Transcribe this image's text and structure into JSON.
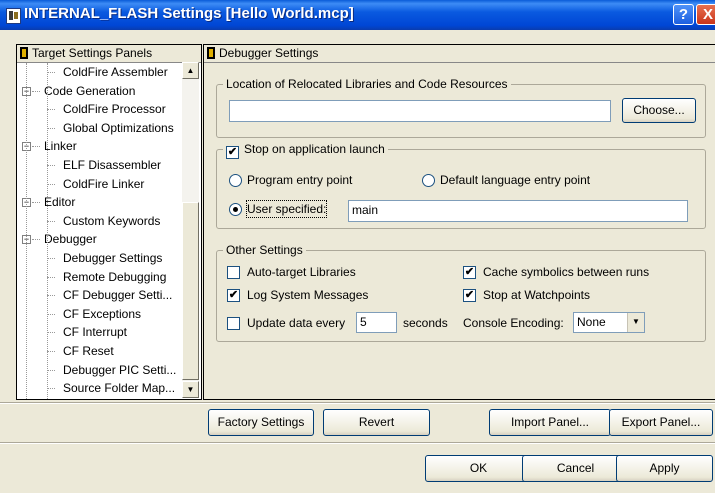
{
  "window": {
    "title": "INTERNAL_FLASH Settings [Hello World.mcp]",
    "help_symbol": "?",
    "close_symbol": "X"
  },
  "left_panel": {
    "header": "Target Settings Panels",
    "tree": [
      {
        "label": "ColdFire Assembler",
        "level": 1
      },
      {
        "label": "Code Generation",
        "level": 0,
        "expander": "−"
      },
      {
        "label": "ColdFire Processor",
        "level": 1
      },
      {
        "label": "Global Optimizations",
        "level": 1
      },
      {
        "label": "Linker",
        "level": 0,
        "expander": "−"
      },
      {
        "label": "ELF Disassembler",
        "level": 1
      },
      {
        "label": "ColdFire Linker",
        "level": 1
      },
      {
        "label": "Editor",
        "level": 0,
        "expander": "−"
      },
      {
        "label": "Custom Keywords",
        "level": 1
      },
      {
        "label": "Debugger",
        "level": 0,
        "expander": "−"
      },
      {
        "label": "Debugger Settings",
        "level": 1
      },
      {
        "label": "Remote Debugging",
        "level": 1
      },
      {
        "label": "CF Debugger Setti...",
        "level": 1
      },
      {
        "label": "CF Exceptions",
        "level": 1
      },
      {
        "label": "CF Interrupt",
        "level": 1
      },
      {
        "label": "CF Reset",
        "level": 1
      },
      {
        "label": "Debugger PIC Setti...",
        "level": 1
      },
      {
        "label": "Source Folder Map...",
        "level": 1
      }
    ],
    "scroll_up": "▲",
    "scroll_down": "▼"
  },
  "right_panel": {
    "header": "Debugger Settings",
    "relocated": {
      "title": "Location of Relocated Libraries and Code Resources",
      "path_value": "",
      "choose_label": "Choose..."
    },
    "stop_on_launch": {
      "label": "Stop on application launch",
      "checked": true,
      "program_entry_label": "Program entry point",
      "default_entry_label": "Default language entry point",
      "user_specified_label": "User specified:",
      "user_specified_value": "main",
      "selected": "user_specified"
    },
    "other_settings": {
      "title": "Other Settings",
      "auto_target_label": "Auto-target Libraries",
      "auto_target_checked": false,
      "log_messages_label": "Log System Messages",
      "log_messages_checked": true,
      "update_data_label": "Update data every",
      "update_data_checked": false,
      "update_interval": "5",
      "seconds_label": "seconds",
      "cache_symbolics_label": "Cache symbolics between runs",
      "cache_symbolics_checked": true,
      "stop_watchpoints_label": "Stop at Watchpoints",
      "stop_watchpoints_checked": true,
      "console_encoding_label": "Console Encoding:",
      "console_encoding_value": "None"
    }
  },
  "panel_buttons": {
    "factory_settings": "Factory Settings",
    "revert": "Revert",
    "import_panel": "Import Panel...",
    "export_panel": "Export Panel..."
  },
  "dialog_buttons": {
    "ok": "OK",
    "cancel": "Cancel",
    "apply": "Apply"
  },
  "check_mark": "✔",
  "dropdown_arrow": "▼"
}
